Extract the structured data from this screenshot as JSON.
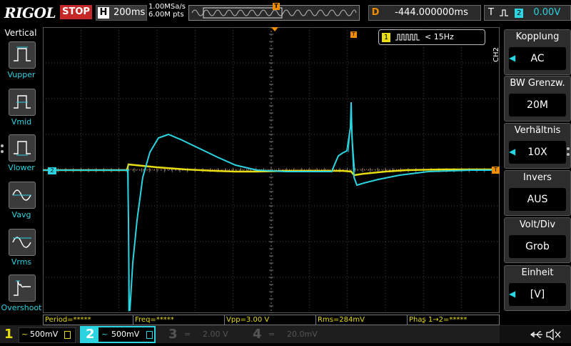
{
  "header": {
    "brand": "RIGOL",
    "run_state": "STOP",
    "timebase_label": "H",
    "timebase_value": "200ms",
    "sample_rate": "1.00MSa/s",
    "memory_depth": "6.00M pts",
    "delay_label": "D",
    "delay_value": "-444.000000ms",
    "trigger_label": "T",
    "trigger_source": "2",
    "trigger_level": "0.00V"
  },
  "left_menu": {
    "title": "Vertical",
    "items": [
      {
        "label": "Vupper",
        "icon": "vupper-icon"
      },
      {
        "label": "Vmid",
        "icon": "vmid-icon"
      },
      {
        "label": "Vlower",
        "icon": "vlower-icon"
      },
      {
        "label": "Vavg",
        "icon": "vavg-icon"
      },
      {
        "label": "Vrms",
        "icon": "vrms-icon"
      },
      {
        "label": "Overshoot",
        "icon": "overshoot-icon"
      }
    ]
  },
  "freq_badge": {
    "channel": "1",
    "text": "< 15Hz"
  },
  "right_menu": {
    "channel_tag": "CH2",
    "groups": [
      {
        "title": "Kopplung",
        "value": "AC",
        "has_arrow": true
      },
      {
        "title": "BW Grenzw.",
        "value": "20M",
        "has_arrow": false
      },
      {
        "title": "Verhältnis",
        "value": "10X",
        "has_arrow": true
      },
      {
        "title": "Invers",
        "value": "AUS",
        "has_arrow": false
      },
      {
        "title": "Volt/Div",
        "value": "Grob",
        "has_arrow": false
      },
      {
        "title": "Einheit",
        "value": "[V]",
        "has_arrow": true
      }
    ]
  },
  "measurements": {
    "period": "Period=*****",
    "freq": "Freq=*****",
    "vpp": "Vpp=3.00 V",
    "rms": "Rms=284mV",
    "phase": "Phaʂ 1→2=*****"
  },
  "channels": [
    {
      "num": "1",
      "scale": "500mV",
      "color": "#e8dc12"
    },
    {
      "num": "2",
      "scale": "500mV",
      "color": "#2ad4e0"
    },
    {
      "num": "3",
      "scale": "2.00 V",
      "color": "#555555"
    },
    {
      "num": "4",
      "scale": "20.0mV",
      "color": "#555555"
    }
  ],
  "marker_labels": {
    "ch2_offset": "2",
    "trig_level": "T",
    "trig_pos": "T"
  },
  "colors": {
    "ch1": "#e8dc12",
    "ch2": "#2ad4e0",
    "trigger": "#f08c00",
    "stop": "#c62828"
  }
}
